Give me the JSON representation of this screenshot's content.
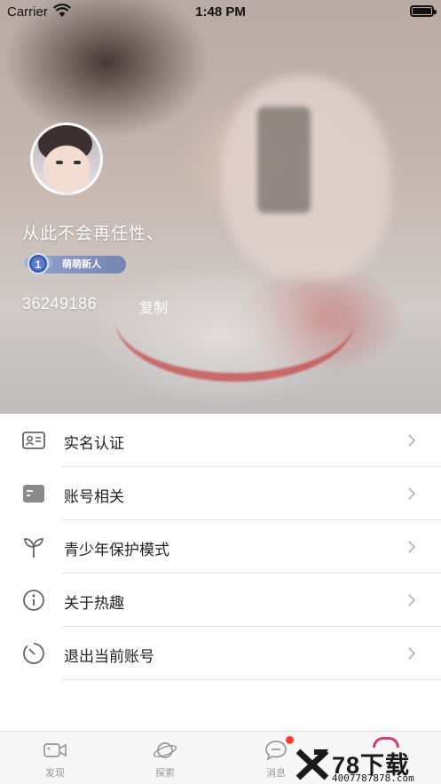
{
  "status_bar": {
    "carrier": "Carrier",
    "time": "1:48 PM"
  },
  "profile": {
    "signature": "从此不会再任性、",
    "level_number": "1",
    "level_title": "萌萌新人",
    "uid": "36249186",
    "copy_label": "复制"
  },
  "menu": {
    "items": [
      {
        "label": "实名认证",
        "icon": "id-card-icon"
      },
      {
        "label": "账号相关",
        "icon": "account-card-icon"
      },
      {
        "label": "青少年保护模式",
        "icon": "sprout-icon"
      },
      {
        "label": "关于热趣",
        "icon": "info-icon"
      },
      {
        "label": "退出当前账号",
        "icon": "logout-timer-icon"
      }
    ]
  },
  "tabbar": {
    "tabs": [
      {
        "label": "发现",
        "icon": "video-camera-icon"
      },
      {
        "label": "探索",
        "icon": "planet-icon"
      },
      {
        "label": "消息",
        "icon": "chat-bubble-icon",
        "badge": true
      }
    ]
  },
  "watermark": {
    "brand": "78下载",
    "phone": "4007787878.com"
  },
  "colors": {
    "badge_red": "#ff3b30",
    "level_pill": "#7f90bd",
    "mine_accent": "#d4397a"
  }
}
